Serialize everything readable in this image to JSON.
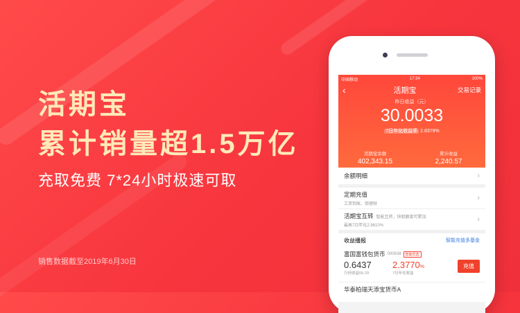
{
  "promo": {
    "headline_1": "活期宝",
    "headline_2": "累计销量超1.5万亿",
    "subline": "充取免费  7*24小时极速可取",
    "footnote": "销售数据截至2019年6月30日"
  },
  "phone": {
    "status": {
      "carrier": "中国移动",
      "time": "17:34",
      "battery": "100%"
    },
    "nav": {
      "back_icon": "chevron-left-icon",
      "title": "活期宝",
      "right_label": "交易记录"
    },
    "summary": {
      "yesterday_label": "昨日收益（元）",
      "yesterday_value": "30.0033",
      "rate_label": "7日年化收益率",
      "rate_value": "2.8379%",
      "balance_label": "活期宝余额",
      "balance_value": "402,343.15",
      "total_label": "累计收益",
      "total_value": "2,240.57"
    },
    "menu": {
      "balance_detail": "余额明细",
      "regular_title": "定期充值",
      "regular_sub": "工资到账、锁理财",
      "transfer_title": "活期宝互转",
      "transfer_note": "智能互转，快取额度可累加",
      "transfer_sub": "最高7日年化2.9610%"
    },
    "earnings": {
      "title": "收益播报",
      "link": "智能充值多基金",
      "fund_name": "富国富钱包货币",
      "fund_code": "000638",
      "fund_tag": "智能优选",
      "unit_value": "0.6437",
      "unit_caption": "万份收益05-29",
      "rate_value": "2.3770",
      "rate_unit": "%",
      "rate_caption": "7日年化收益",
      "button": "充值",
      "next_name": "华泰柏瑞天添宝货币A"
    }
  },
  "colors": {
    "brand_red": "#f0412c",
    "headline": "#ffe9b8",
    "link_blue": "#3a7be0"
  }
}
